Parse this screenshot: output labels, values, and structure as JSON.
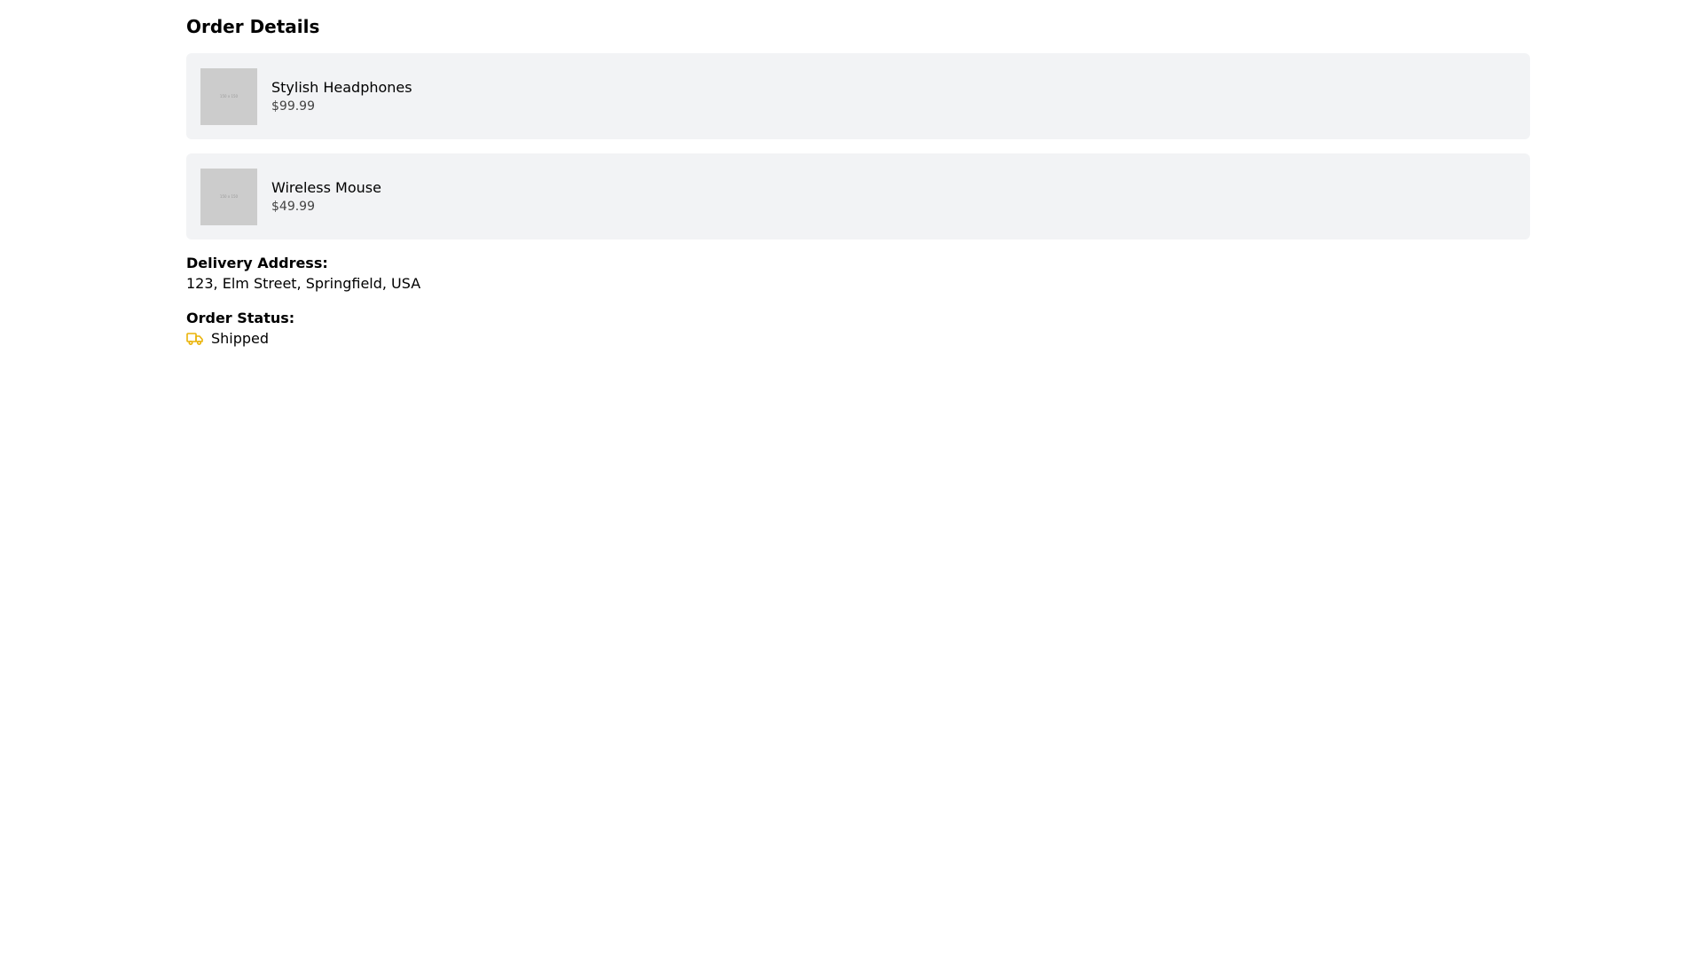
{
  "page": {
    "title": "Order Details"
  },
  "items": [
    {
      "name": "Stylish Headphones",
      "price": "$99.99",
      "thumbnail_label": "150 x 150"
    },
    {
      "name": "Wireless Mouse",
      "price": "$49.99",
      "thumbnail_label": "150 x 150"
    }
  ],
  "delivery": {
    "label": "Delivery Address:",
    "address": "123, Elm Street, Springfield, USA"
  },
  "status": {
    "label": "Order Status:",
    "value": "Shipped",
    "icon": "truck-icon",
    "icon_color": "#eab308"
  }
}
